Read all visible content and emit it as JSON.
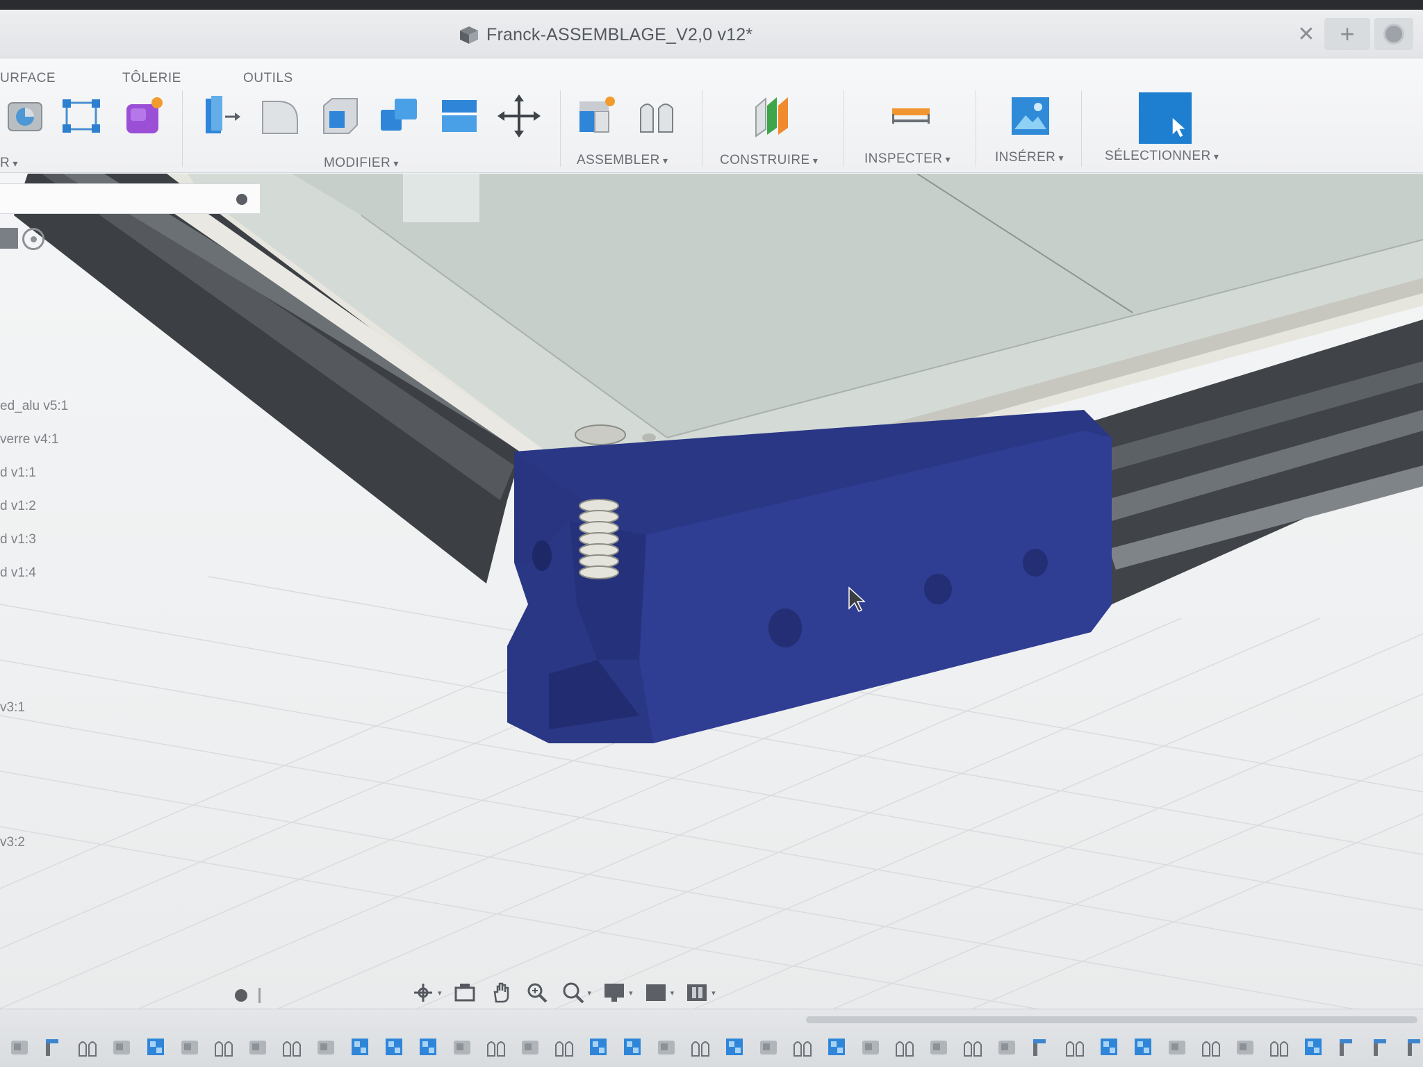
{
  "window": {
    "title": "Franck-ASSEMBLAGE_V2,0 v12*"
  },
  "ribbon": {
    "tabs": [
      "URFACE",
      "TÔLERIE",
      "OUTILS"
    ],
    "groups": {
      "create_partial": "R",
      "modify": "MODIFIER",
      "assemble": "ASSEMBLER",
      "construct": "CONSTRUIRE",
      "inspect": "INSPECTER",
      "insert": "INSÉRER",
      "select": "SÉLECTIONNER"
    }
  },
  "browser": {
    "items": [
      "ed_alu v5:1",
      "verre v4:1",
      "d v1:1",
      "d v1:2",
      "d v1:3",
      "d v1:4",
      "v3:1",
      "v3:2"
    ]
  },
  "colors": {
    "accent": "#1e7fd0",
    "part_blue": "#2b3a8e",
    "plate": "#dcdbd2",
    "glass": "#c9d3cf",
    "extrusion": "#4b4f53"
  },
  "icons": {
    "window": "cube-icon",
    "timeline_types": [
      "sketch-icon",
      "joint-icon",
      "component-icon",
      "extrude-icon"
    ]
  }
}
